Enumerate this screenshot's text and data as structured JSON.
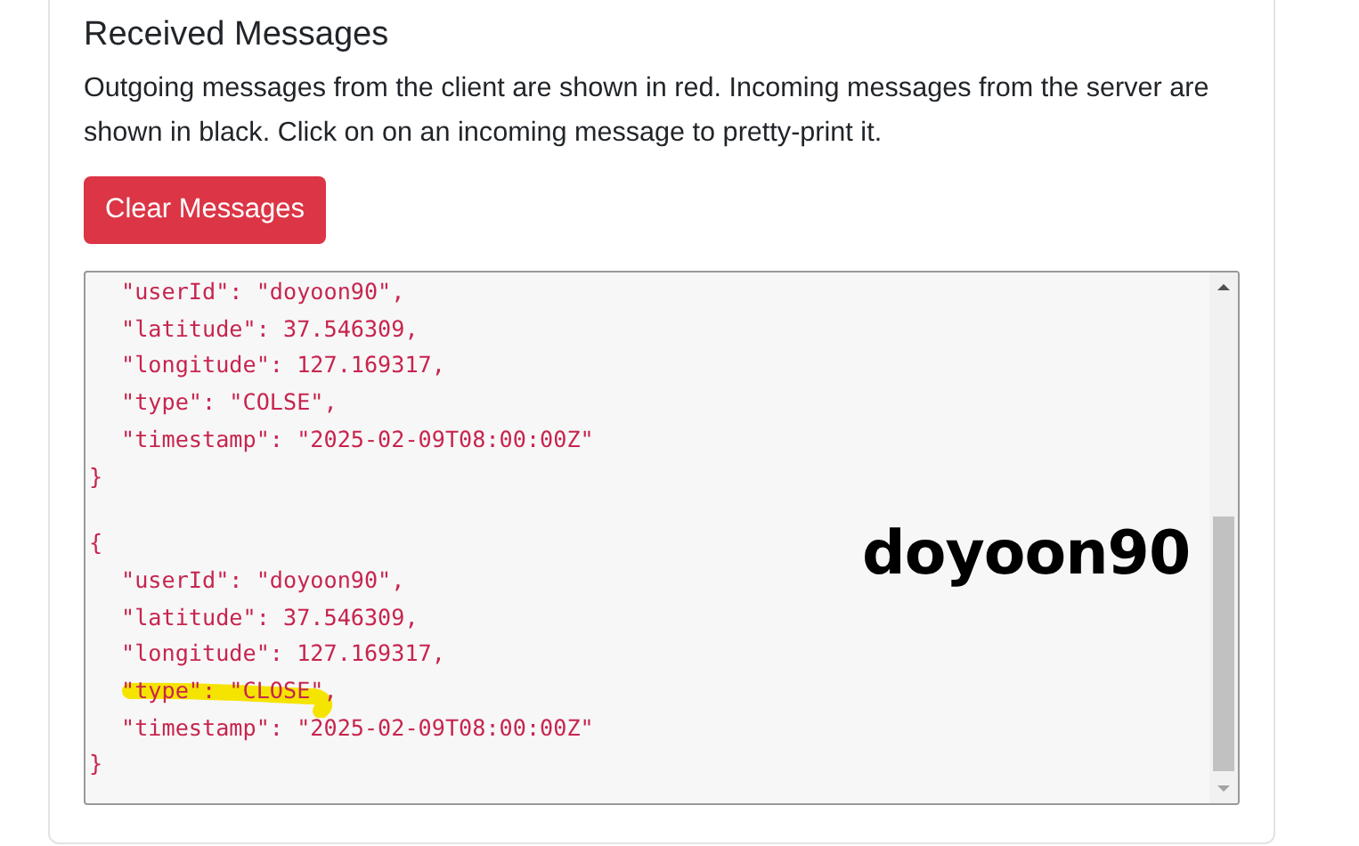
{
  "section": {
    "title": "Received Messages",
    "description": "Outgoing messages from the client are shown in red. Incoming messages from the server are shown in black. Click on on an incoming message to pretty-print it.",
    "clear_button": "Clear Messages"
  },
  "messages": [
    {
      "fields": [
        {
          "text": "\"userId\": \"doyoon90\",",
          "highlighted": false
        },
        {
          "text": "\"latitude\": 37.546309,",
          "highlighted": false
        },
        {
          "text": "\"longitude\": 127.169317,",
          "highlighted": false
        },
        {
          "text": "\"type\": \"COLSE\",",
          "highlighted": false
        },
        {
          "text": "\"timestamp\": \"2025-02-09T08:00:00Z\"",
          "highlighted": false
        }
      ],
      "close": "}"
    },
    {
      "open": "{",
      "fields": [
        {
          "text": "\"userId\": \"doyoon90\",",
          "highlighted": false
        },
        {
          "text": "\"latitude\": 37.546309,",
          "highlighted": false
        },
        {
          "text": "\"longitude\": 127.169317,",
          "highlighted": false
        },
        {
          "text": "\"type\": \"CLOSE\",",
          "highlighted": true
        },
        {
          "text": "\"timestamp\": \"2025-02-09T08:00:00Z\"",
          "highlighted": false
        }
      ],
      "close": "}"
    }
  ],
  "annotation": {
    "text": "doyoon90"
  }
}
